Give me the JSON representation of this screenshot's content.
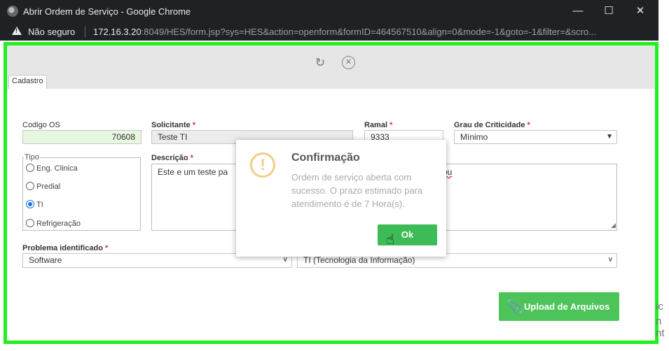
{
  "browser": {
    "title": "Abrir Ordem de Serviço - Google Chrome",
    "security_label": "Não seguro",
    "url_host": "172.16.3.20",
    "url_rest": ":8049/HES/form.jsp?sys=HES&action=openform&formID=464567510&align=0&mode=-1&goto=-1&filter=&scro...",
    "minimize_icon": "minimize-icon",
    "maximize_icon": "maximize-icon",
    "close_icon": "close-icon"
  },
  "toolbar": {
    "refresh_icon": "refresh-icon",
    "close_icon": "close-circle-icon"
  },
  "tab": {
    "label": "Cadastro"
  },
  "form": {
    "codigo_os": {
      "label": "Codigo OS",
      "value": "70608"
    },
    "solicitante": {
      "label": "Solicitante",
      "required": "*",
      "value": "Teste TI"
    },
    "ramal": {
      "label": "Ramal",
      "required": "*",
      "value": "9333"
    },
    "grau": {
      "label": "Grau de Criticidade",
      "required": "*",
      "value": "Mínimo"
    },
    "tipo": {
      "legend": "Tipo",
      "options": [
        "Eng. Clinica",
        "Predial",
        "TI",
        "Refrigeração"
      ],
      "selected": "TI"
    },
    "descricao": {
      "label": "Descrição",
      "required": "*",
      "value_left": "Este e um teste pa",
      "value_right": "ou"
    },
    "problema": {
      "label": "Problema identificado",
      "required": "*",
      "value": "Software"
    },
    "setor": {
      "value": "TI (Tecnologia da Informação)"
    },
    "upload_label": "Upload de Arquivos"
  },
  "modal": {
    "title": "Confirmação",
    "message": "Ordem de serviço aberta com sucesso. O prazo estimado para atendimento é de 7 Hora(s).",
    "ok_label": "Ok",
    "icon": "warning-icon"
  },
  "background_fragments": [
    "ic",
    "n",
    "nt"
  ],
  "colors": {
    "frame": "#22ee22",
    "ok_button": "#3dbb57",
    "upload_button": "#4cc45a",
    "warning": "#f2cd85"
  }
}
